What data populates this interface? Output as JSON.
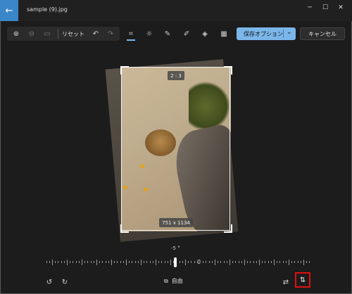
{
  "window": {
    "title": "sample (9).jpg",
    "back_icon": "←",
    "minimize_icon": "─",
    "maximize_icon": "☐",
    "close_icon": "✕"
  },
  "toolbar": {
    "zoom_in_icon": "⊕",
    "zoom_out_icon": "⊖",
    "fit_icon": "▭",
    "reset_label": "リセット",
    "undo_icon": "↶",
    "redo_icon": "↷",
    "crop_icon": "⌗",
    "adjust_icon": "☼",
    "markup_icon": "✎",
    "draw_icon": "✐",
    "erase_icon": "◈",
    "filter_icon": "▦",
    "save_label": "保存オプション",
    "save_chevron": "⌄",
    "cancel_label": "キャンセル"
  },
  "canvas": {
    "aspect_ratio": "2 : 3",
    "dimensions": "751 x 1134"
  },
  "straighten": {
    "angle_text": "-5 °",
    "zero_label": "0",
    "angle_value": -5
  },
  "bottom": {
    "rotate_left_icon": "↺",
    "rotate_right_icon": "↻",
    "aspect_icon": "⧉",
    "freeform_label": "自由",
    "flip_h_icon": "⇄",
    "flip_v_icon": "⇅"
  },
  "colors": {
    "accent": "#7bb6ea",
    "highlight_box": "#e01010"
  }
}
